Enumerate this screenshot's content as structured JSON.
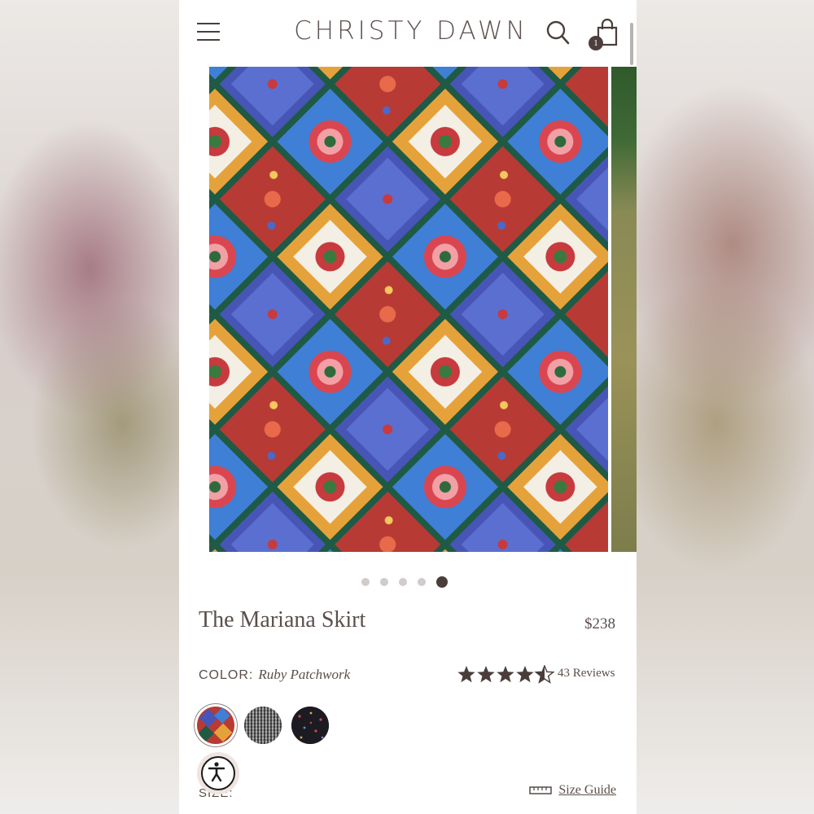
{
  "header": {
    "brand": "CHRISTY DAWN",
    "cart_count": "1"
  },
  "gallery": {
    "image_count": 5,
    "active_index": 5
  },
  "product": {
    "title": "The Mariana Skirt",
    "price": "$238",
    "color_label": "COLOR:",
    "color_value": "Ruby Patchwork",
    "rating": 4.5,
    "reviews_label": "43 Reviews",
    "swatches": [
      "Ruby Patchwork",
      "Gray Gingham",
      "Black Floral"
    ]
  },
  "size": {
    "label_partial": "SIZE:",
    "guide_label": "Size Guide"
  },
  "colors": {
    "text": "#5a4f4b",
    "badge": "#4c3f3b",
    "star": "#4a3e3a"
  }
}
